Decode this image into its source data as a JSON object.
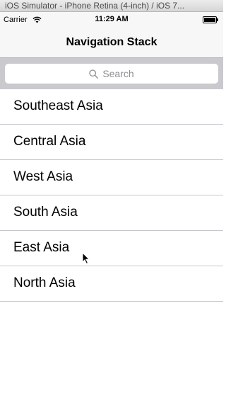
{
  "window": {
    "title": "iOS Simulator - iPhone Retina (4-inch) / iOS 7..."
  },
  "status_bar": {
    "carrier": "Carrier",
    "time": "11:29 AM",
    "icons": [
      "wifi-icon",
      "battery-icon"
    ]
  },
  "nav": {
    "title": "Navigation Stack"
  },
  "search": {
    "placeholder": "Search",
    "icon": "search-icon"
  },
  "table": {
    "rows": [
      {
        "label": "Southeast Asia"
      },
      {
        "label": "Central Asia"
      },
      {
        "label": "West Asia"
      },
      {
        "label": "South Asia"
      },
      {
        "label": "East Asia"
      },
      {
        "label": "North Asia"
      }
    ]
  },
  "colors": {
    "bar_background": "#f7f7f7",
    "search_bar_background": "#c9c9ce",
    "separator": "#c8c7cc",
    "placeholder": "#8e8e93"
  }
}
